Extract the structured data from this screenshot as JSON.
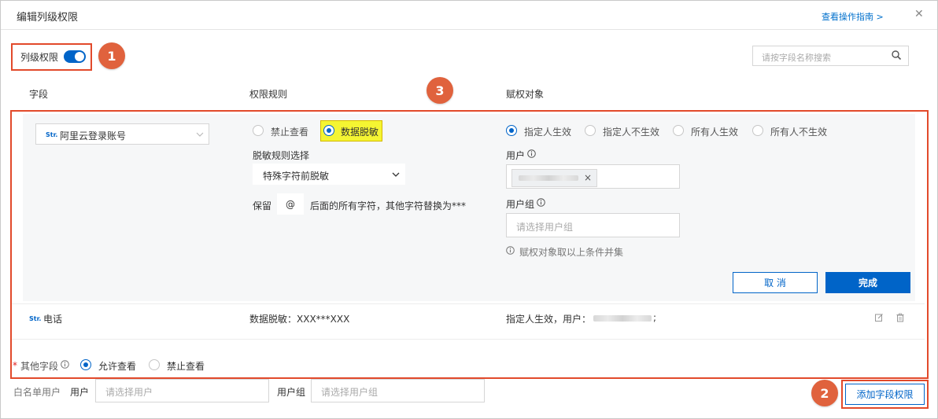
{
  "dialog": {
    "title": "编辑列级权限",
    "guide_link": "查看操作指南 >",
    "close": "✕"
  },
  "toolbar": {
    "toggle_label": "列级权限",
    "toggle_on": true,
    "search_placeholder": "请按字段名称搜索"
  },
  "callouts": [
    "1",
    "2",
    "3"
  ],
  "table": {
    "headers": [
      "字段",
      "权限规则",
      "赋权对象"
    ]
  },
  "edit_row": {
    "field_tag": "Str.",
    "field_name": "阿里云登录账号",
    "rule_options": [
      "禁止查看",
      "数据脱敏"
    ],
    "rule_selected": "数据脱敏",
    "mask_rule_label": "脱敏规则选择",
    "mask_rule_value": "特殊字符前脱敏",
    "keep_prefix": "保留",
    "keep_char": "@",
    "keep_suffix": "后面的所有字符，其他字符替换为***",
    "target_options": [
      "指定人生效",
      "指定人不生效",
      "所有人生效",
      "所有人不生效"
    ],
    "target_selected": "指定人生效",
    "user_label": "用户",
    "chip_close": "×",
    "group_label": "用户组",
    "group_placeholder": "请选择用户组",
    "union_note": "赋权对象取以上条件并集",
    "cancel": "取 消",
    "done": "完成"
  },
  "rows": [
    {
      "tag": "Str.",
      "name": "电话",
      "rule": "数据脱敏：XXX***XXX",
      "target_prefix": "指定人生效，用户：",
      "target_suffix": ";"
    }
  ],
  "other_fields": {
    "required_mark": "*",
    "label": "其他字段",
    "options": [
      "允许查看",
      "禁止查看"
    ],
    "selected": "允许查看"
  },
  "whitelist": {
    "label": "白名单用户",
    "user_label": "用户",
    "user_placeholder": "请选择用户",
    "group_label": "用户组",
    "group_placeholder": "请选择用户组"
  },
  "add_button": "添加字段权限",
  "colors": {
    "primary": "#0064c8",
    "callout": "#e24a2b",
    "highlight": "#f5f532"
  }
}
